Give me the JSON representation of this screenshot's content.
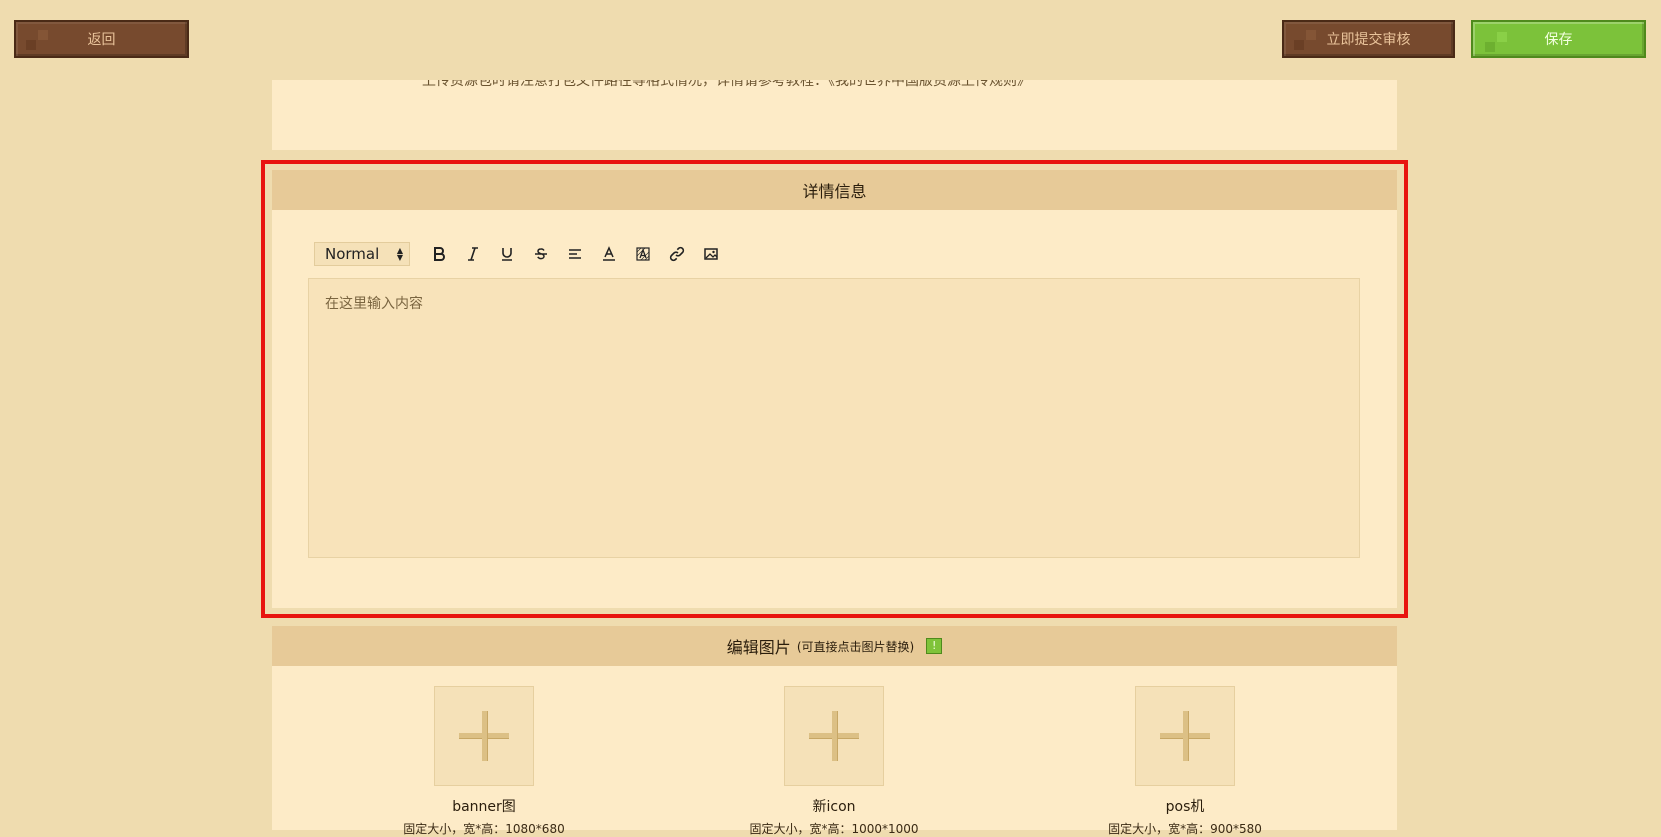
{
  "top_bar": {
    "back_label": "返回",
    "submit_label": "立即提交审核",
    "save_label": "保存"
  },
  "upload_note": "上传资源包时请注意打包文件路径等格式情况，详情请参考教程：《我的世界中国版资源上传规则》",
  "detail": {
    "title": "详情信息",
    "format_select": "Normal",
    "editor_placeholder": "在这里输入内容"
  },
  "images": {
    "title": "编辑图片",
    "hint": "(可直接点击图片替换)",
    "info_badge": "!",
    "slots": [
      {
        "name": "banner图",
        "size_text": "固定大小，宽*高：1080*680"
      },
      {
        "name": "新icon",
        "size_text": "固定大小，宽*高：1000*1000"
      },
      {
        "name": "pos机",
        "size_text": "固定大小，宽*高：900*580"
      }
    ]
  },
  "colors": {
    "page_bg": "#efdcaf",
    "panel_bg": "#fdebc7",
    "header_bg": "#e7ca98",
    "highlight_border": "#e8140f",
    "save_green": "#7cc23a",
    "brown_button": "#774a2e"
  }
}
